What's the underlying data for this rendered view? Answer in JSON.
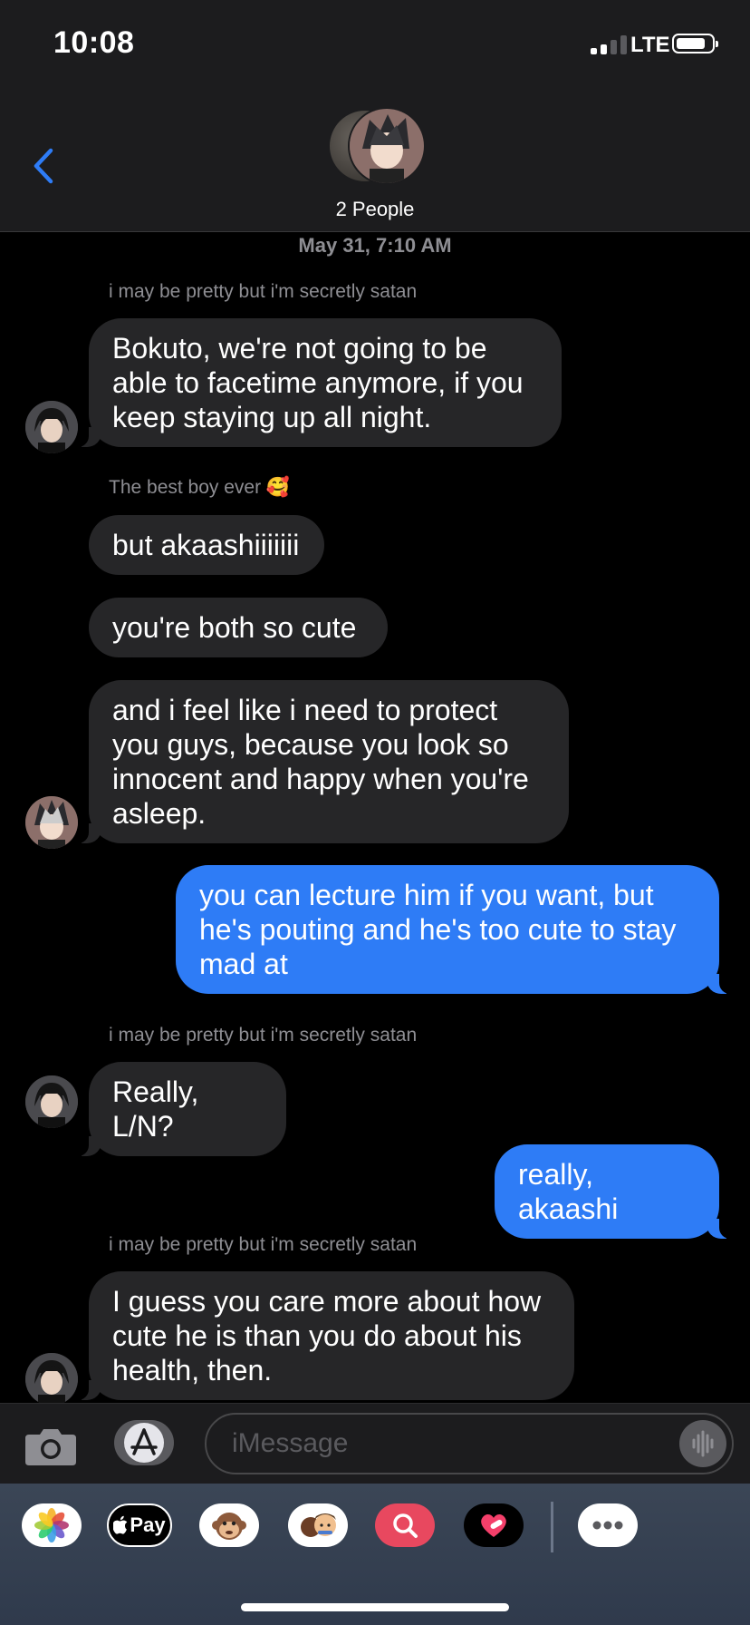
{
  "status_bar": {
    "time": "10:08",
    "network": "LTE"
  },
  "header": {
    "group_label": "2 People"
  },
  "conversation": {
    "date_stamp": "May 31, 7:10 AM",
    "senders": {
      "akaashi": "i may be pretty but i'm secretly satan",
      "bokuto": "The best boy ever 🥰"
    },
    "messages": [
      {
        "from": "akaashi",
        "text": "Bokuto, we're not going to be able to facetime anymore, if you keep staying up all night."
      },
      {
        "from": "bokuto",
        "text": "but akaashiiiiiii"
      },
      {
        "from": "bokuto",
        "text": "you're both so cute"
      },
      {
        "from": "bokuto",
        "text": "and i feel like i need to protect you guys, because you look so innocent and happy when you're asleep."
      },
      {
        "from": "me",
        "text": "you can lecture him if you want, but he's pouting and he's too cute to stay mad at"
      },
      {
        "from": "akaashi",
        "text": "Really, L/N?"
      },
      {
        "from": "me",
        "text": "really, akaashi"
      },
      {
        "from": "akaashi",
        "text": "I guess you care more about how cute he is than you do about his health, then."
      }
    ]
  },
  "compose": {
    "placeholder": "iMessage"
  },
  "app_drawer": {
    "apps": [
      "photos-icon",
      "apple-pay",
      "animoji-icon",
      "memoji-icon",
      "image-search-icon",
      "heart-app-icon",
      "more-apps-icon"
    ],
    "apple_pay_label": "Pay"
  },
  "colors": {
    "outgoing_bubble": "#2e7cf6",
    "incoming_bubble": "#262628",
    "header_bg": "#1c1c1e"
  }
}
